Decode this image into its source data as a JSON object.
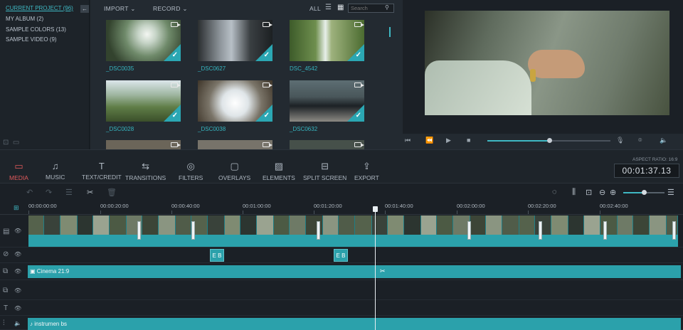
{
  "library": {
    "items": [
      {
        "label": "CURRENT PROJECT (96)",
        "active": true
      },
      {
        "label": "MY ALBUM (2)",
        "active": false
      },
      {
        "label": "SAMPLE COLORS (13)",
        "active": false
      },
      {
        "label": "SAMPLE VIDEO (9)",
        "active": false
      }
    ],
    "collapse_glyph": "←"
  },
  "media_toolbar": {
    "import_label": "IMPORT",
    "record_label": "RECORD",
    "filter_label": "ALL",
    "search_placeholder": "Search"
  },
  "media_items": [
    {
      "name": "_DSC0035"
    },
    {
      "name": "_DSC0627"
    },
    {
      "name": "DSC_4542"
    },
    {
      "name": "_DSC0028"
    },
    {
      "name": "_DSC0038"
    },
    {
      "name": "_DSC0632"
    }
  ],
  "functions": [
    {
      "label": "MEDIA",
      "icon": "folder-icon",
      "glyph": "▭",
      "active": true
    },
    {
      "label": "MUSIC",
      "icon": "music-icon",
      "glyph": "♫",
      "active": false
    },
    {
      "label": "TEXT/CREDIT",
      "icon": "text-icon",
      "glyph": "T",
      "active": false
    },
    {
      "label": "TRANSITIONS",
      "icon": "transition-icon",
      "glyph": "⇆",
      "active": false
    },
    {
      "label": "FILTERS",
      "icon": "filter-icon",
      "glyph": "◎",
      "active": false
    },
    {
      "label": "OVERLAYS",
      "icon": "overlay-icon",
      "glyph": "▢",
      "active": false
    },
    {
      "label": "ELEMENTS",
      "icon": "image-icon",
      "glyph": "▨",
      "active": false
    },
    {
      "label": "SPLIT SCREEN",
      "icon": "split-screen-icon",
      "glyph": "⊟",
      "active": false
    },
    {
      "label": "EXPORT",
      "icon": "export-icon",
      "glyph": "⇪",
      "active": false
    }
  ],
  "aspect_ratio": "ASPECT RATIO: 16:9",
  "timecode": "00:01:37.13",
  "ruler": [
    "00:00:00:00",
    "00:00:20:00",
    "00:00:40:00",
    "00:01:00:00",
    "00:01:20:00",
    "00:01:40:00",
    "00:02:00:00",
    "00:02:20:00",
    "00:02:40:00"
  ],
  "playback": {
    "progress": 0.5
  },
  "zoom": {
    "level": 0.5
  },
  "tracks": {
    "text_badge": "B",
    "pip_clip": "Cinema 21:9",
    "audio_clip": "instrumen bs"
  },
  "colors": {
    "accent": "#2ba1ab",
    "active_function": "#e0595b",
    "bg": "#1b2026"
  }
}
